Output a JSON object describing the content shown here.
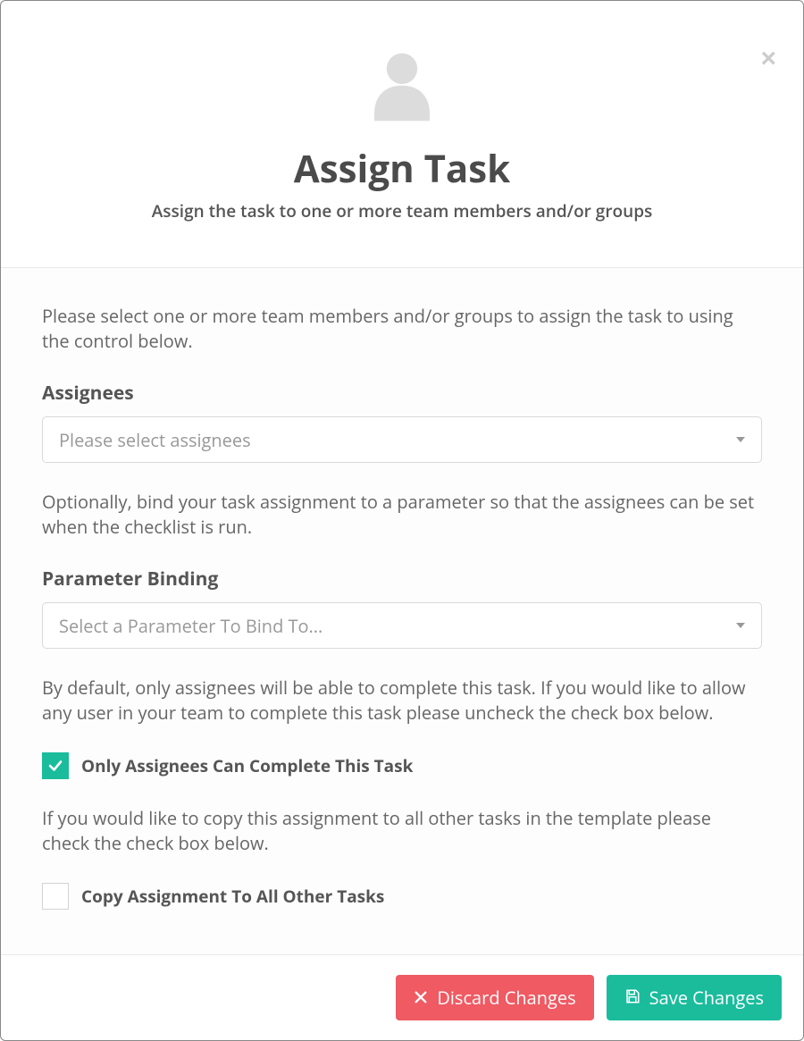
{
  "header": {
    "title": "Assign Task",
    "subtitle": "Assign the task to one or more team members and/or groups"
  },
  "body": {
    "intro": "Please select one or more team members and/or groups to assign the task to using the control below.",
    "assignees_label": "Assignees",
    "assignees_placeholder": "Please select assignees",
    "param_intro": "Optionally, bind your task assignment to a parameter so that the assignees can be set when the checklist is run.",
    "param_label": "Parameter Binding",
    "param_placeholder": "Select a Parameter To Bind To...",
    "only_assignees_intro": "By default, only assignees will be able to complete this task. If you would like to allow any user in your team to complete this task please uncheck the check box below.",
    "only_assignees_label": "Only Assignees Can Complete This Task",
    "only_assignees_checked": true,
    "copy_intro": "If you would like to copy this assignment to all other tasks in the template please check the check box below.",
    "copy_label": "Copy Assignment To All Other Tasks",
    "copy_checked": false
  },
  "footer": {
    "discard_label": "Discard Changes",
    "save_label": "Save Changes"
  },
  "colors": {
    "accent": "#1abc9c",
    "danger": "#ef5a63"
  }
}
